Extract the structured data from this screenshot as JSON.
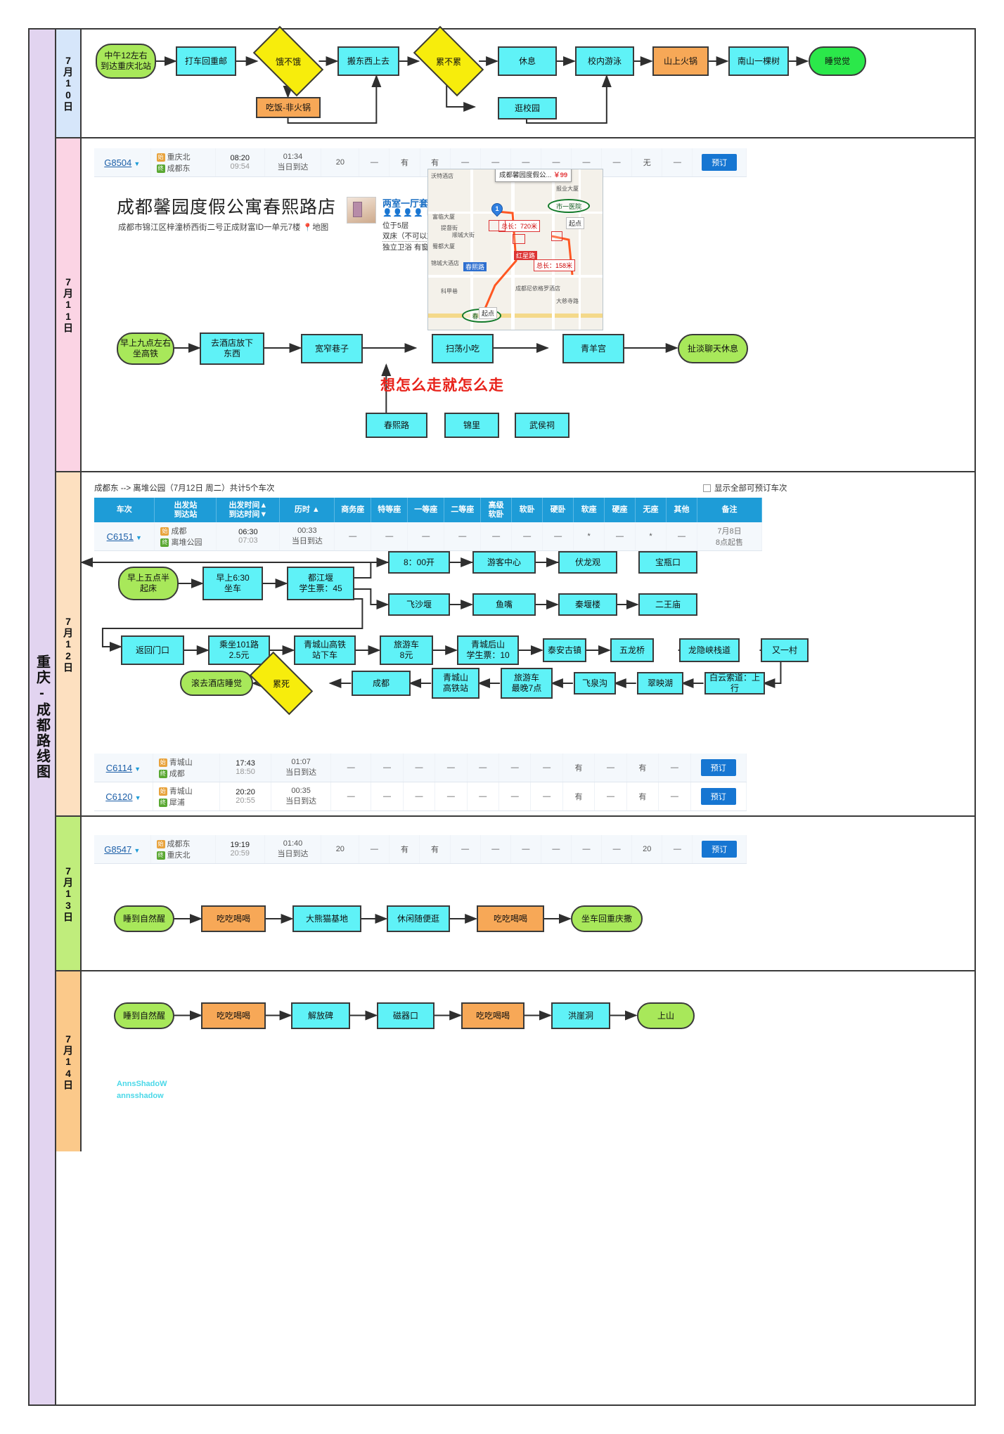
{
  "page": {
    "title": "重庆-成都路线图"
  },
  "days": [
    {
      "label": "7月10日"
    },
    {
      "label": "7月11日"
    },
    {
      "label": "7月12日"
    },
    {
      "label": "7月13日"
    },
    {
      "label": "7月14日"
    }
  ],
  "day1": {
    "nodes": [
      {
        "id": "n1",
        "text": "中午12左右\n到达重庆北站",
        "shape": "rounded",
        "color": "green"
      },
      {
        "id": "n2",
        "text": "打车回重邮",
        "shape": "rect",
        "color": "cyan"
      },
      {
        "id": "n3",
        "text": "饿不饿",
        "shape": "diamond",
        "color": "yellow"
      },
      {
        "id": "n4",
        "text": "吃饭-非火锅",
        "shape": "rect",
        "color": "orange"
      },
      {
        "id": "n5",
        "text": "搬东西上去",
        "shape": "rect",
        "color": "cyan"
      },
      {
        "id": "n6",
        "text": "累不累",
        "shape": "diamond",
        "color": "yellow"
      },
      {
        "id": "n7",
        "text": "休息",
        "shape": "rect",
        "color": "cyan"
      },
      {
        "id": "n8",
        "text": "逛校园",
        "shape": "rect",
        "color": "cyan"
      },
      {
        "id": "n9",
        "text": "校内游泳",
        "shape": "rect",
        "color": "cyan"
      },
      {
        "id": "n10",
        "text": "山上火锅",
        "shape": "rect",
        "color": "orange"
      },
      {
        "id": "n11",
        "text": "南山一棵树",
        "shape": "rect",
        "color": "cyan"
      },
      {
        "id": "n12",
        "text": "睡觉觉",
        "shape": "rounded",
        "color": "green2"
      }
    ]
  },
  "day2": {
    "train": {
      "number": "G8504",
      "from_station": "重庆北",
      "to_station": "成都东",
      "depart": "08:20",
      "arrive": "09:54",
      "duration": "01:34",
      "arrive_note": "当日到达",
      "seats": [
        "20",
        "—",
        "有",
        "有",
        "—",
        "—",
        "—",
        "—",
        "—",
        "—",
        "无",
        "—"
      ],
      "book_label": "预订"
    },
    "hotel": {
      "name": "成都馨园度假公寓春熙路店",
      "address": "成都市锦江区梓潼桥西街二号正成财富ID一单元7楼",
      "map_link": "地图",
      "room_type": "两室一厅套房",
      "floor": "位于5层",
      "bed": "双床（不可以加床）",
      "amenities": "独立卫浴 有窗"
    },
    "map": {
      "tooltip_name": "成都馨园度假公...",
      "tooltip_price": "￥99",
      "marker": "1",
      "dist1": "总长：720米",
      "dist2": "总长：158米",
      "start1": "起点",
      "start2": "起点",
      "hospital": "市一医院",
      "metro": "春熙路",
      "label_hongxing": "红星路",
      "label_chunxi": "春熙路",
      "pois": [
        "沃特酒店",
        "报业大厦",
        "富临大厦",
        "蜀都大厦",
        "锦城大酒店",
        "科甲巷",
        "成都尼依格罗酒店",
        "大慈寺路",
        "顺城大街",
        "提督街"
      ]
    },
    "note": "想怎么走就怎么走",
    "nodes": [
      {
        "id": "m1",
        "text": "早上九点左右\n坐高铁",
        "shape": "rounded",
        "color": "green"
      },
      {
        "id": "m2",
        "text": "去酒店放下\n东西",
        "shape": "rect",
        "color": "cyan"
      },
      {
        "id": "m3",
        "text": "宽窄巷子",
        "shape": "rect",
        "color": "cyan"
      },
      {
        "id": "m4",
        "text": "扫荡小吃",
        "shape": "rect",
        "color": "cyan"
      },
      {
        "id": "m5",
        "text": "青羊宫",
        "shape": "rect",
        "color": "cyan"
      },
      {
        "id": "m6",
        "text": "扯淡聊天休息",
        "shape": "rounded",
        "color": "green"
      },
      {
        "id": "m7",
        "text": "春熙路",
        "shape": "rect",
        "color": "cyan"
      },
      {
        "id": "m8",
        "text": "锦里",
        "shape": "rect",
        "color": "cyan"
      },
      {
        "id": "m9",
        "text": "武侯祠",
        "shape": "rect",
        "color": "cyan"
      }
    ]
  },
  "day3": {
    "caption": "成都东 --> 离堆公园（7月12日 周二）共计5个车次",
    "checkbox_label": "显示全部可预订车次",
    "headers": [
      "车次",
      "出发站\n到达站",
      "出发时间▲\n到达时间▼",
      "历时 ▲",
      "商务座",
      "特等座",
      "一等座",
      "二等座",
      "高级\n软卧",
      "软卧",
      "硬卧",
      "软座",
      "硬座",
      "无座",
      "其他",
      "备注"
    ],
    "top_train": {
      "number": "C6151",
      "from_station": "成都",
      "to_station": "离堆公园",
      "depart": "06:30",
      "arrive": "07:03",
      "duration": "00:33",
      "arrive_note": "当日到达",
      "cells": [
        "—",
        "—",
        "—",
        "—",
        "—",
        "—",
        "—",
        "*",
        "—",
        "*",
        "—"
      ],
      "remark": "7月8日\n8点起售"
    },
    "bottom_trains": [
      {
        "number": "C6114",
        "from_station": "青城山",
        "to_station": "成都",
        "depart": "17:43",
        "arrive": "18:50",
        "duration": "01:07",
        "arrive_note": "当日到达",
        "cells": [
          "—",
          "—",
          "—",
          "—",
          "—",
          "—",
          "—",
          "有",
          "—",
          "有",
          "—"
        ],
        "book_label": "预订"
      },
      {
        "number": "C6120",
        "from_station": "青城山",
        "to_station": "犀浦",
        "depart": "20:20",
        "arrive": "20:55",
        "duration": "00:35",
        "arrive_note": "当日到达",
        "cells": [
          "—",
          "—",
          "—",
          "—",
          "—",
          "—",
          "—",
          "有",
          "—",
          "有",
          "—"
        ],
        "book_label": "预订"
      }
    ],
    "nodes": [
      {
        "id": "p1",
        "text": "早上五点半\n起床",
        "shape": "rounded",
        "color": "green"
      },
      {
        "id": "p2",
        "text": "早上6:30\n坐车",
        "shape": "rect",
        "color": "cyan"
      },
      {
        "id": "p3",
        "text": "都江堰\n学生票：45",
        "shape": "rect",
        "color": "cyan"
      },
      {
        "id": "p4",
        "text": "8：00开",
        "shape": "rect",
        "color": "cyan"
      },
      {
        "id": "p5",
        "text": "游客中心",
        "shape": "rect",
        "color": "cyan"
      },
      {
        "id": "p6",
        "text": "伏龙观",
        "shape": "rect",
        "color": "cyan"
      },
      {
        "id": "p7",
        "text": "宝瓶口",
        "shape": "rect",
        "color": "cyan"
      },
      {
        "id": "p8",
        "text": "飞沙堰",
        "shape": "rect",
        "color": "cyan"
      },
      {
        "id": "p9",
        "text": "鱼嘴",
        "shape": "rect",
        "color": "cyan"
      },
      {
        "id": "p10",
        "text": "秦堰楼",
        "shape": "rect",
        "color": "cyan"
      },
      {
        "id": "p11",
        "text": "二王庙",
        "shape": "rect",
        "color": "cyan"
      },
      {
        "id": "p12",
        "text": "返回门口",
        "shape": "rect",
        "color": "cyan"
      },
      {
        "id": "p13",
        "text": "乘坐101路\n2.5元",
        "shape": "rect",
        "color": "cyan"
      },
      {
        "id": "p14",
        "text": "青城山高铁\n站下车",
        "shape": "rect",
        "color": "cyan"
      },
      {
        "id": "p15",
        "text": "旅游车\n8元",
        "shape": "rect",
        "color": "cyan"
      },
      {
        "id": "p16",
        "text": "青城后山\n学生票：10",
        "shape": "rect",
        "color": "cyan"
      },
      {
        "id": "p17",
        "text": "泰安古镇",
        "shape": "rect",
        "color": "cyan"
      },
      {
        "id": "p18",
        "text": "五龙桥",
        "shape": "rect",
        "color": "cyan"
      },
      {
        "id": "p19",
        "text": "龙隐峡栈道",
        "shape": "rect",
        "color": "cyan"
      },
      {
        "id": "p20",
        "text": "又一村",
        "shape": "rect",
        "color": "cyan"
      },
      {
        "id": "p21",
        "text": "白云索道：上行",
        "shape": "rect",
        "color": "cyan"
      },
      {
        "id": "p22",
        "text": "翠映湖",
        "shape": "rect",
        "color": "cyan"
      },
      {
        "id": "p23",
        "text": "飞泉沟",
        "shape": "rect",
        "color": "cyan"
      },
      {
        "id": "p24",
        "text": "旅游车\n最晚7点",
        "shape": "rect",
        "color": "cyan"
      },
      {
        "id": "p25",
        "text": "青城山\n高铁站",
        "shape": "rect",
        "color": "cyan"
      },
      {
        "id": "p26",
        "text": "成都",
        "shape": "rect",
        "color": "cyan"
      },
      {
        "id": "p27",
        "text": "累死",
        "shape": "diamond",
        "color": "yellow"
      },
      {
        "id": "p28",
        "text": "滚去酒店睡觉",
        "shape": "rounded",
        "color": "green"
      }
    ]
  },
  "day4": {
    "train": {
      "number": "G8547",
      "from_station": "成都东",
      "to_station": "重庆北",
      "depart": "19:19",
      "arrive": "20:59",
      "duration": "01:40",
      "arrive_note": "当日到达",
      "cells": [
        "20",
        "—",
        "有",
        "有",
        "—",
        "—",
        "—",
        "—",
        "—",
        "—",
        "20",
        "—"
      ],
      "book_label": "预订"
    },
    "nodes": [
      {
        "id": "q1",
        "text": "睡到自然醒",
        "shape": "rounded",
        "color": "green"
      },
      {
        "id": "q2",
        "text": "吃吃喝喝",
        "shape": "rect",
        "color": "orange"
      },
      {
        "id": "q3",
        "text": "大熊猫基地",
        "shape": "rect",
        "color": "cyan"
      },
      {
        "id": "q4",
        "text": "休闲随便逛",
        "shape": "rect",
        "color": "cyan"
      },
      {
        "id": "q5",
        "text": "吃吃喝喝",
        "shape": "rect",
        "color": "orange"
      },
      {
        "id": "q6",
        "text": "坐车回重庆撒",
        "shape": "rounded",
        "color": "green"
      }
    ]
  },
  "day5": {
    "nodes": [
      {
        "id": "r1",
        "text": "睡到自然醒",
        "shape": "rounded",
        "color": "green"
      },
      {
        "id": "r2",
        "text": "吃吃喝喝",
        "shape": "rect",
        "color": "orange"
      },
      {
        "id": "r3",
        "text": "解放碑",
        "shape": "rect",
        "color": "cyan"
      },
      {
        "id": "r4",
        "text": "磁器口",
        "shape": "rect",
        "color": "cyan"
      },
      {
        "id": "r5",
        "text": "吃吃喝喝",
        "shape": "rect",
        "color": "orange"
      },
      {
        "id": "r6",
        "text": "洪崖洞",
        "shape": "rect",
        "color": "cyan"
      },
      {
        "id": "r7",
        "text": "上山",
        "shape": "rounded",
        "color": "green"
      }
    ],
    "signature_line1": "AnnsShadoW",
    "signature_line2": "annsshadow"
  },
  "colors": {
    "cyan": "#5ff2f7",
    "green": "#a8e85a",
    "green_bright": "#2be84a",
    "orange": "#f7a857",
    "yellow": "#f7ed0c",
    "table_header": "#1e9cd7",
    "book_button": "#1676d2",
    "red_note": "#e8231b"
  }
}
